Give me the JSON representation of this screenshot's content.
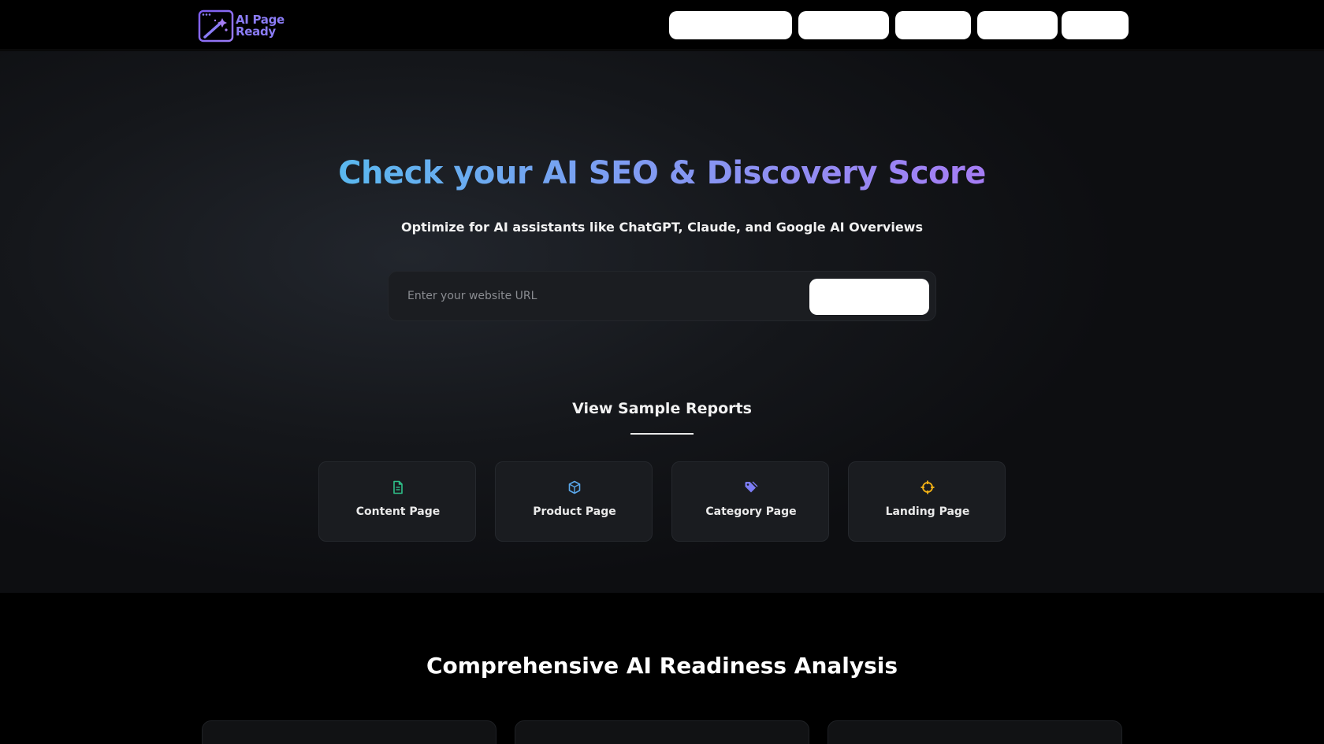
{
  "app": {
    "logo_line1": "AI Page",
    "logo_line2": "Ready"
  },
  "nav": {
    "buttons": [
      "",
      "",
      "",
      "",
      ""
    ]
  },
  "hero": {
    "title": "Check your AI SEO & Discovery Score",
    "subtitle": "Optimize for AI assistants like ChatGPT, Claude, and Google AI Overviews",
    "url_placeholder": "Enter your website URL",
    "url_value": "",
    "submit_label": ""
  },
  "samples": {
    "heading": "View Sample Reports",
    "cards": [
      {
        "label": "Content Page",
        "icon": "document-icon",
        "color": "#2fc18a"
      },
      {
        "label": "Product Page",
        "icon": "cube-icon",
        "color": "#5aa7ea"
      },
      {
        "label": "Category Page",
        "icon": "tag-icon",
        "color": "#7c7cf4"
      },
      {
        "label": "Landing Page",
        "icon": "crosshair-icon",
        "color": "#f5b316"
      }
    ]
  },
  "features": {
    "heading": "Comprehensive AI Readiness Analysis"
  },
  "colors": {
    "brand": "#8b7cf6",
    "title_gradient_start": "#5ab8ef",
    "title_gradient_end": "#a57cf4"
  }
}
